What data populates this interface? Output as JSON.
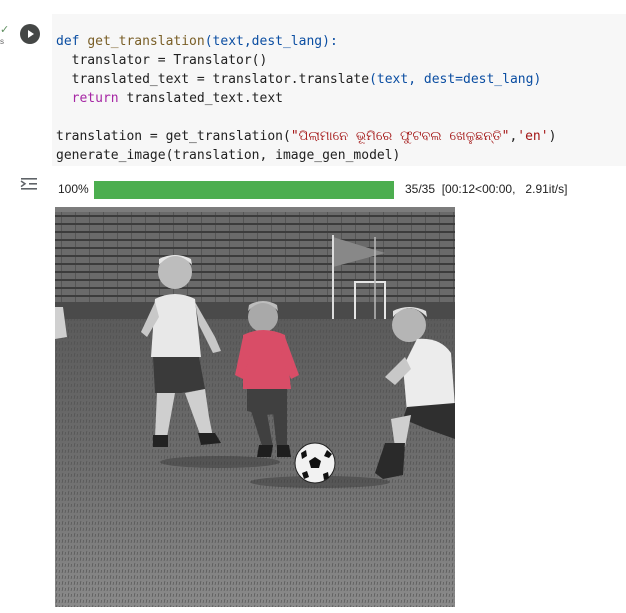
{
  "cell": {
    "exec_status": "✓",
    "exec_time": "s",
    "code_lines": {
      "l1_def": "def ",
      "l1_name": "get_translation",
      "l1_args": "(text,dest_lang):",
      "l2": "  translator = Translator()",
      "l3_a": "  translated_text = translator.translate",
      "l3_b": "(text, dest=dest_lang)",
      "l4_kw": "  return",
      "l4_rest": " translated_text.text",
      "l6_a": "translation = get_translation(",
      "l6_str": "\"ପିଲାମାନେ ଭୂମିରେ ଫୁଟବଲ ଖେଳୁଛନ୍ତି\"",
      "l6_b": ",",
      "l6_str2": "'en'",
      "l6_c": ")",
      "l7": "generate_image(translation, image_gen_model)"
    }
  },
  "output": {
    "progress_percent_label": "100%",
    "progress_value": 1.0,
    "progress_stats": "35/35  [00:12<00:00,   2.91it/s]"
  },
  "colors": {
    "progress": "#4cae4f",
    "keyword": "#0b4ea2",
    "string": "#a31515",
    "return_keyword": "#a626a4",
    "function_name": "#795e26"
  },
  "icons": {
    "run": "play-circle-icon",
    "output": "output-toggle-icon",
    "status": "checkmark-icon"
  }
}
